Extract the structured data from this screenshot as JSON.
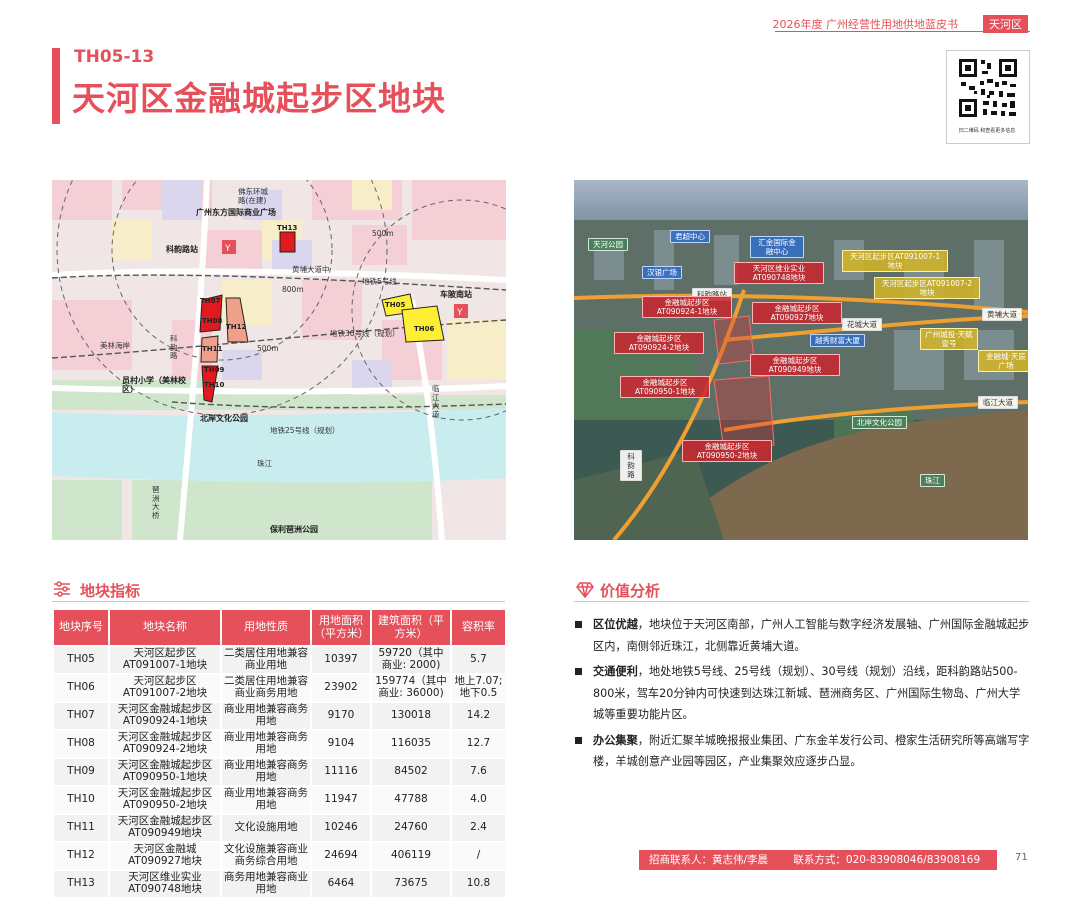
{
  "header": {
    "book_title": "2026年度 广州经营性用地供地蓝皮书",
    "district_tag": "天河区"
  },
  "plot": {
    "code": "TH05-13",
    "title": "天河区金融城起步区地块"
  },
  "qr": {
    "note": "扫二维码 和查看更多信息"
  },
  "map": {
    "labels": {
      "intl_business": "广州东方国际商业广场",
      "foshan_ring": "佛东环城路(在建)",
      "keyun_station": "科韵路站",
      "huangpu_road": "黄埔大道中",
      "metro5": "地铁5号线",
      "chepi_south": "车陂南站",
      "metro30": "地铁30号线（规划）",
      "kelu": "科韵路",
      "meilin": "美林海岸",
      "school": "员村小学（美林校区）",
      "beian_park": "北岸文化公园",
      "metro25": "地铁25号线（规划）",
      "zhujiang": "珠江",
      "bridge": "琶洲大桥",
      "poly_park": "保利琶洲公园",
      "linjiang": "临江大道",
      "m500a": "500m",
      "m500b": "500m",
      "m800": "800m"
    },
    "plots": [
      "TH05",
      "TH06",
      "TH07",
      "TH08",
      "TH09",
      "TH10",
      "TH11",
      "TH12",
      "TH13"
    ]
  },
  "aerial": {
    "labels": {
      "tianhe_park": "天河公园",
      "junchao": "君超中心",
      "finance_center": "汇金国际金融中心",
      "yinhe": "汉银广场",
      "keyun": "科韵路站",
      "plot_th13": "天河区维业实业AT090748地块",
      "plot_th05": "天河区起步区AT091007-1地块",
      "plot_th06": "天河区起步区AT091007-2地块",
      "plot_th07": "金融城起步区AT090924-1地块",
      "plot_th12": "金融城起步区AT090927地块",
      "plot_th08": "金融城起步区AT090924-2地块",
      "plot_th11": "金融城起步区AT090949地块",
      "plot_th09": "金融城起步区AT090950-1地块",
      "plot_th10": "金融城起步区AT090950-2地块",
      "huangpu": "黄埔大道",
      "huacheng": "花城大道",
      "yuexiu": "越秀财富大厦",
      "gztf": "广州城投·天赋壹号",
      "tianchen": "金融城·天辰广场",
      "linjiang": "临江大道",
      "beian": "北岸文化公园",
      "kelu": "科韵路",
      "zhujiang": "珠江"
    }
  },
  "indicators": {
    "heading": "地块指标",
    "headers": [
      "地块序号",
      "地块名称",
      "用地性质",
      "用地面积（平方米）",
      "建筑面积（平方米）",
      "容积率"
    ],
    "rows": [
      [
        "TH05",
        "天河区起步区AT091007-1地块",
        "二类居住用地兼容商业用地",
        "10397",
        "59720（其中商业: 2000)",
        "5.7"
      ],
      [
        "TH06",
        "天河区起步区AT091007-2地块",
        "二类居住用地兼容商业商务用地",
        "23902",
        "159774（其中商业: 36000)",
        "地上7.07;地下0.5"
      ],
      [
        "TH07",
        "天河区金融城起步区AT090924-1地块",
        "商业用地兼容商务用地",
        "9170",
        "130018",
        "14.2"
      ],
      [
        "TH08",
        "天河区金融城起步区AT090924-2地块",
        "商业用地兼容商务用地",
        "9104",
        "116035",
        "12.7"
      ],
      [
        "TH09",
        "天河区金融城起步区AT090950-1地块",
        "商业用地兼容商务用地",
        "11116",
        "84502",
        "7.6"
      ],
      [
        "TH10",
        "天河区金融城起步区AT090950-2地块",
        "商业用地兼容商务用地",
        "11947",
        "47788",
        "4.0"
      ],
      [
        "TH11",
        "天河区金融城起步区AT090949地块",
        "文化设施用地",
        "10246",
        "24760",
        "2.4"
      ],
      [
        "TH12",
        "天河区金融城AT090927地块",
        "文化设施兼容商业商务综合用地",
        "24694",
        "406119",
        "/"
      ],
      [
        "TH13",
        "天河区维业实业AT090748地块",
        "商务用地兼容商业用地",
        "6464",
        "73675",
        "10.8"
      ]
    ]
  },
  "analysis": {
    "heading": "价值分析",
    "items": [
      {
        "title": "区位优越",
        "text": "，地块位于天河区南部，广州人工智能与数字经济发展轴、广州国际金融城起步区内，南侧邻近珠江，北侧靠近黄埔大道。"
      },
      {
        "title": "交通便利",
        "text": "，地处地铁5号线、25号线（规划）、30号线（规划）沿线，距科韵路站500-800米，驾车20分钟内可快速到达珠江新城、琶洲商务区、广州国际生物岛、广州大学城等重要功能片区。"
      },
      {
        "title": "办公集聚",
        "text": "，附近汇聚羊城晚报报业集团、广东金羊发行公司、橙家生活研究所等高端写字楼，羊城创意产业园等园区，产业集聚效应逐步凸显。"
      }
    ]
  },
  "footer": {
    "contact": "招商联系人：黄志伟/李晨",
    "phone": "联系方式：020-83908046/83908169",
    "page": "71"
  }
}
